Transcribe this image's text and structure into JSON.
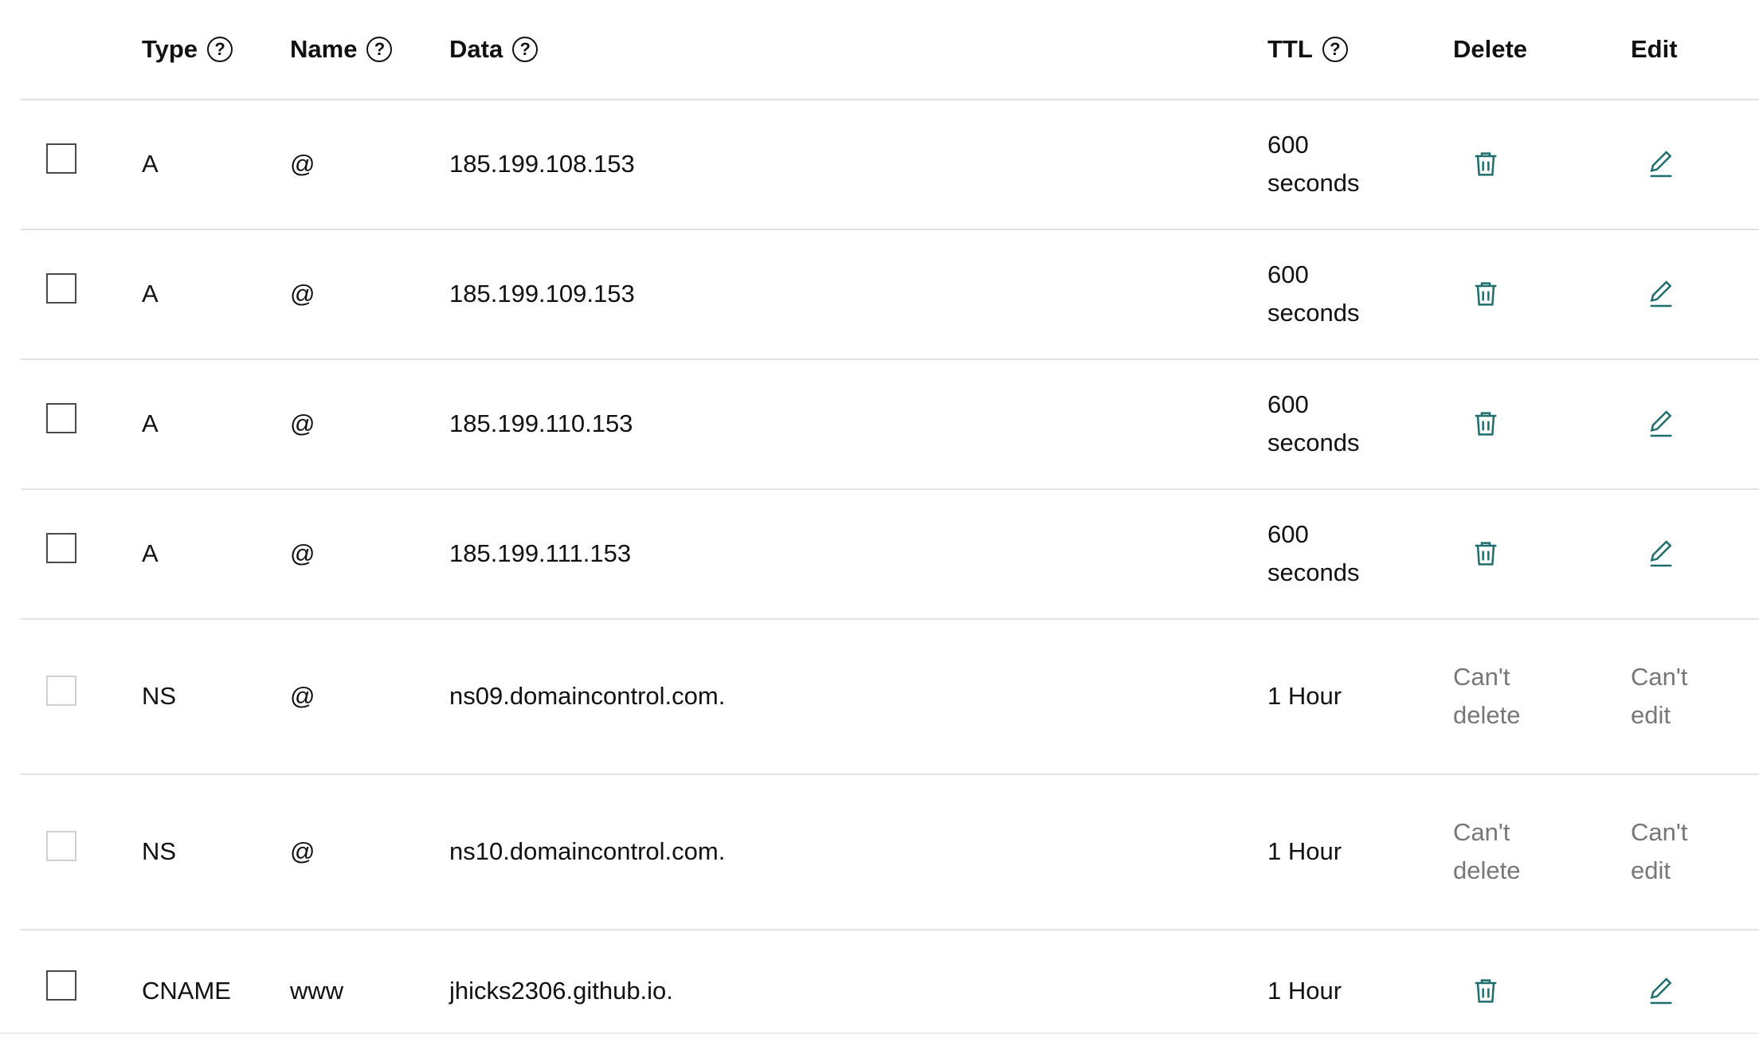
{
  "columns": {
    "type": "Type",
    "name": "Name",
    "data": "Data",
    "ttl": "TTL",
    "delete": "Delete",
    "edit": "Edit",
    "help_glyph": "?"
  },
  "records": [
    {
      "type": "A",
      "name": "@",
      "data": "185.199.108.153",
      "ttl_line1": "600",
      "ttl_line2": "seconds"
    },
    {
      "type": "A",
      "name": "@",
      "data": "185.199.109.153",
      "ttl_line1": "600",
      "ttl_line2": "seconds"
    },
    {
      "type": "A",
      "name": "@",
      "data": "185.199.110.153",
      "ttl_line1": "600",
      "ttl_line2": "seconds"
    },
    {
      "type": "A",
      "name": "@",
      "data": "185.199.111.153",
      "ttl_line1": "600",
      "ttl_line2": "seconds"
    },
    {
      "type": "NS",
      "name": "@",
      "data": "ns09.domaincontrol.com.",
      "ttl": "1 Hour",
      "delete_line1": "Can't",
      "delete_line2": "delete",
      "edit_line1": "Can't",
      "edit_line2": "edit"
    },
    {
      "type": "NS",
      "name": "@",
      "data": "ns10.domaincontrol.com.",
      "ttl": "1 Hour",
      "delete_line1": "Can't",
      "delete_line2": "delete",
      "edit_line1": "Can't",
      "edit_line2": "edit"
    },
    {
      "type": "CNAME",
      "name": "www",
      "data": "jhicks2306.github.io.",
      "ttl": "1 Hour"
    }
  ],
  "icons": {
    "delete": "trash-icon",
    "edit": "pencil-icon",
    "help": "help-circle-icon"
  },
  "colors": {
    "action_icon": "#1f6e6e",
    "muted_text": "#777777",
    "divider": "#e2e2e2"
  }
}
